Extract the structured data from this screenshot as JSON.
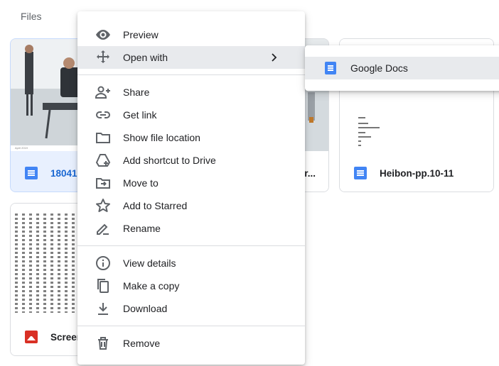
{
  "section": {
    "label": "Files"
  },
  "files": [
    {
      "name": "18041",
      "type": "doc",
      "thumb_caption": "April 2019"
    },
    {
      "name": "or...",
      "type": "doc"
    },
    {
      "name": "Heibon-pp.10-11",
      "type": "doc"
    },
    {
      "name": "Screen",
      "type": "image"
    }
  ],
  "context_menu": {
    "items": [
      {
        "label": "Preview",
        "icon": "eye-icon"
      },
      {
        "label": "Open with",
        "icon": "move-arrows-icon",
        "has_submenu": true
      },
      {
        "label": "Share",
        "icon": "person-add-icon"
      },
      {
        "label": "Get link",
        "icon": "link-icon"
      },
      {
        "label": "Show file location",
        "icon": "folder-icon"
      },
      {
        "label": "Add shortcut to Drive",
        "icon": "drive-shortcut-icon"
      },
      {
        "label": "Move to",
        "icon": "folder-move-icon"
      },
      {
        "label": "Add to Starred",
        "icon": "star-icon"
      },
      {
        "label": "Rename",
        "icon": "pencil-icon"
      },
      {
        "label": "View details",
        "icon": "info-icon"
      },
      {
        "label": "Make a copy",
        "icon": "copy-icon"
      },
      {
        "label": "Download",
        "icon": "download-icon"
      },
      {
        "label": "Remove",
        "icon": "trash-icon"
      }
    ]
  },
  "submenu": {
    "items": [
      {
        "label": "Google Docs",
        "icon": "google-docs-icon"
      }
    ]
  },
  "colors": {
    "docs_blue": "#4285f4",
    "image_red": "#d93025",
    "selected_bg": "#e8f0fe",
    "hover_bg": "#e8eaed"
  }
}
